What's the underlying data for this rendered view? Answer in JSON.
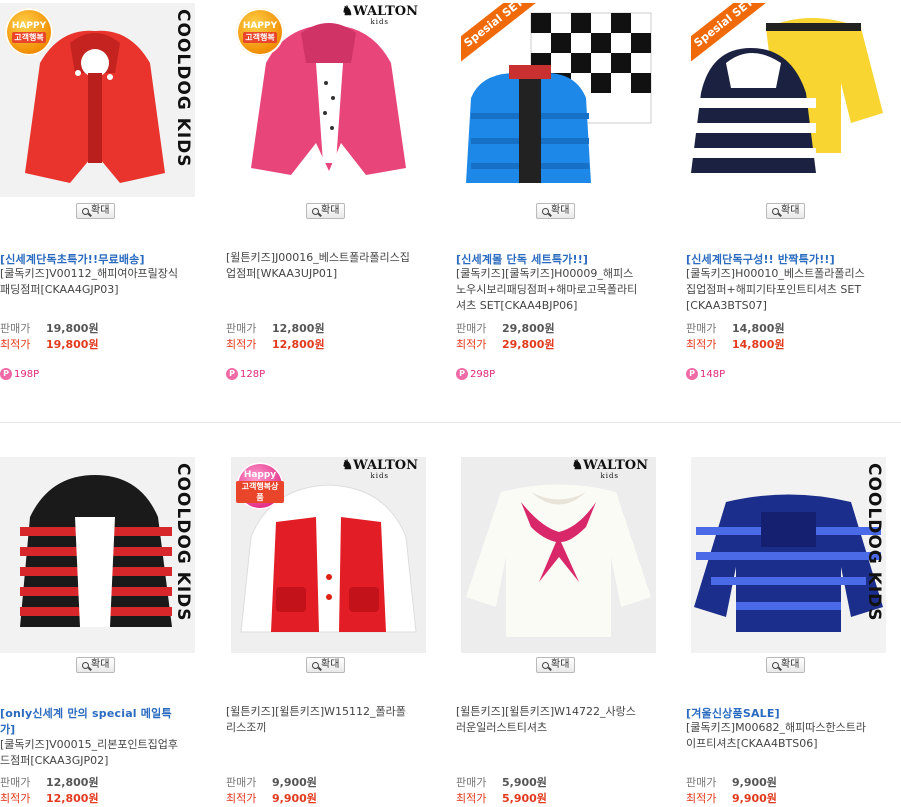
{
  "zoom_label": "확대",
  "sale_label": "판매가",
  "best_label": "최적가",
  "products": [
    {
      "promo": "[신세계단독초특가!!무료배송]",
      "promo2": "",
      "name": "[쿨독키즈]V00112_해피여아프릴장식\n패딩점퍼[CKAA4GJP03]",
      "sale_price": "19,800원",
      "best_price": "19,800원",
      "points": "198P",
      "brand": "COOLDOG KIDS",
      "badge": "HAPPY 고객행복"
    },
    {
      "promo": "",
      "promo2": "",
      "name": "[윌튼키즈]J00016_베스트폴라폴리스집\n업점퍼[WKAA3UJP01]",
      "sale_price": "12,800원",
      "best_price": "12,800원",
      "points": "128P",
      "brand": "WALTON",
      "badge": "HAPPY 고객행복"
    },
    {
      "promo": "[신세계몰 단독 세트특가!!]",
      "promo2": "",
      "name": "[쿨독키즈][쿨독키즈]H00009_해피스\n노우시보리패딩점퍼+해마로고목폴라티\n셔츠 SET[CKAA4BJP06]",
      "sale_price": "29,800원",
      "best_price": "29,800원",
      "points": "298P",
      "brand": "",
      "badge": "Spesial SET"
    },
    {
      "promo": "[신세계단독구성!! 반짝특가!!]",
      "promo2": "",
      "name": "[쿨독키즈]H00010_베스트폴라폴리스\n집업점퍼+해피기타포인트티셔츠 SET\n[CKAA3BTS07]",
      "sale_price": "14,800원",
      "best_price": "14,800원",
      "points": "148P",
      "brand": "",
      "badge": "Spesial SET"
    },
    {
      "promo": "[only신세계 만의 special 메일특",
      "promo2": "가]",
      "name": "[쿨독키즈]V00015_리본포인트집업후\n드점퍼[CKAA3GJP02]",
      "sale_price": "12,800원",
      "best_price": "12,800원",
      "points": "",
      "brand": "COOLDOG KIDS",
      "badge": ""
    },
    {
      "promo": "",
      "promo2": "",
      "name": "[윌튼키즈][윌튼키즈]W15112_폴라폴\n리스조끼",
      "sale_price": "9,900원",
      "best_price": "9,900원",
      "points": "",
      "brand": "WALTON",
      "badge": "Happy 고객행복상품"
    },
    {
      "promo": "",
      "promo2": "",
      "name": "[윌튼키즈][윌튼키즈]W14722_사랑스\n러운일러스트티셔츠",
      "sale_price": "5,900원",
      "best_price": "5,900원",
      "points": "",
      "brand": "WALTON",
      "badge": ""
    },
    {
      "promo": "[겨울신상품SALE]",
      "promo2": "",
      "name": "[쿨독키즈]M00682_해피따스한스트라\n이프티셔츠[CKAA4BTS06]",
      "sale_price": "9,900원",
      "best_price": "9,900원",
      "points": "",
      "brand": "COOLDOG KIDS",
      "badge": ""
    }
  ]
}
